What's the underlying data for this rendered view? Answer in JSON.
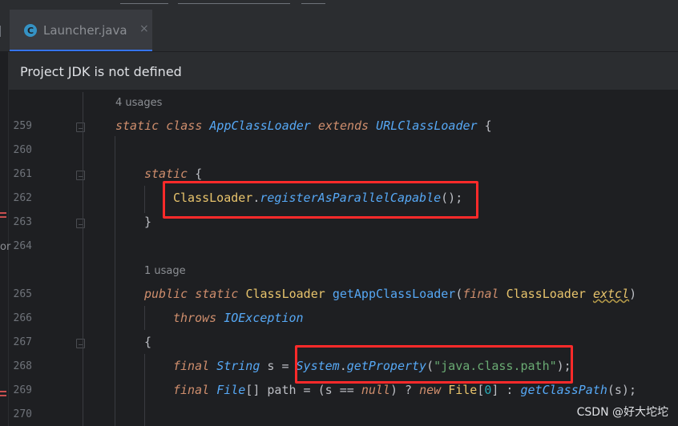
{
  "tab": {
    "label": "Launcher.java",
    "icon_letter": "C",
    "close": "×"
  },
  "banner": {
    "text": "Project JDK is not defined"
  },
  "hints": {
    "usages_4": "4 usages",
    "usages_1": "1 usage"
  },
  "line_numbers": [
    "259",
    "260",
    "261",
    "262",
    "263",
    "264",
    "265",
    "266",
    "267",
    "268",
    "269",
    "270"
  ],
  "left_fragment": "or",
  "code": {
    "l259": {
      "k1": "static",
      "k2": "class",
      "name": "AppClassLoader",
      "k3": "extends",
      "super": "URLClassLoader",
      "tail": " {"
    },
    "l261": {
      "k1": "static",
      "tail": " {"
    },
    "l262": {
      "cls": "ClassLoader",
      "dot": ".",
      "method": "registerAsParallelCapable",
      "tail": "();"
    },
    "l263": {
      "tail": "}"
    },
    "l265": {
      "k1": "public",
      "k2": "static",
      "ret": "ClassLoader",
      "method": "getAppClassLoader",
      "open": "(",
      "k3": "final",
      "ptype": "ClassLoader",
      "param": "extcl",
      "close": ")"
    },
    "l266": {
      "k1": "throws",
      "exc": "IOException"
    },
    "l267": {
      "tail": "{"
    },
    "l268": {
      "k1": "final",
      "type": "String",
      "var": " s = ",
      "cls": "System",
      "dot": ".",
      "method": "getProperty",
      "open": "(",
      "str": "\"java.class.path\"",
      "close": ");"
    },
    "l269": {
      "k1": "final",
      "type": "File",
      "arr": "[] path = (s == ",
      "nul": "null",
      "mid": ") ? ",
      "k2": "new",
      "cls": "File",
      "o": "[",
      "num": "0",
      "c": "] : ",
      "method": "getClassPath",
      "end": "(s);"
    }
  },
  "watermark": "CSDN @好大坨坨",
  "colors": {
    "background": "#1e1f22",
    "keyword": "#cf8e6d",
    "class": "#e8c46c",
    "method": "#56a8f5",
    "string": "#6aab73",
    "number": "#2aacb8",
    "highlight_box": "#ff2a2a"
  }
}
